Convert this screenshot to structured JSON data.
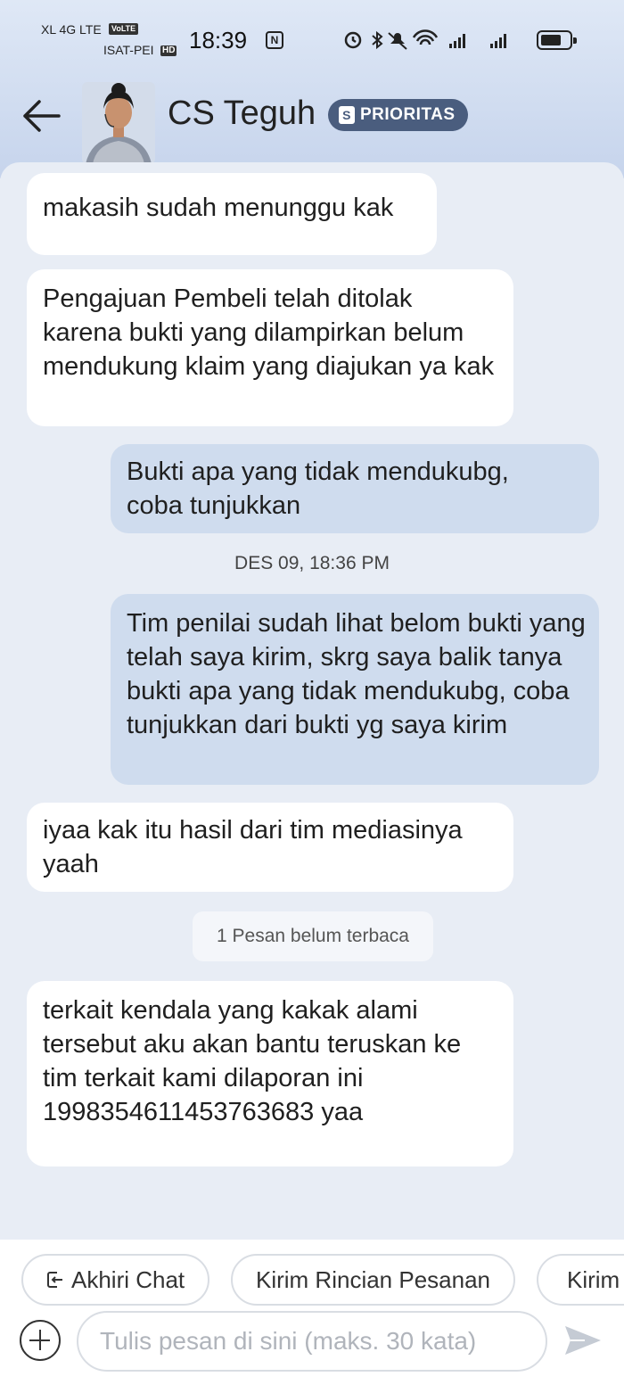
{
  "status_bar": {
    "carrier1": "XL 4G LTE",
    "volte": "VoLTE",
    "carrier2": "ISAT-PEI",
    "hd": "HD",
    "time": "18:39",
    "nfc": "N",
    "icons": [
      "alarm-icon",
      "bluetooth-icon",
      "mute-icon",
      "wifi-icon",
      "signal-icon",
      "signal-icon",
      "battery-icon"
    ]
  },
  "header": {
    "title": "CS Teguh",
    "badge": "PRIORITAS",
    "badge_icon": "shopee-bag-icon"
  },
  "messages": [
    {
      "side": "in",
      "text": "makasih sudah menunggu kak"
    },
    {
      "side": "in",
      "text": "Pengajuan Pembeli telah ditolak karena bukti yang dilampirkan belum mendukung klaim yang diajukan ya kak"
    },
    {
      "side": "out",
      "text": "Bukti apa yang tidak mendukubg, coba tunjukkan"
    },
    {
      "side": "date",
      "text": "DES 09, 18:36 PM"
    },
    {
      "side": "out",
      "text": "Tim penilai sudah lihat belom bukti yang telah saya kirim, skrg saya balik tanya bukti apa yang tidak mendukubg, coba tunjukkan dari bukti yg saya kirim"
    },
    {
      "side": "in",
      "text": "iyaa kak itu hasil dari tim mediasinya yaah"
    },
    {
      "side": "unread",
      "text": "1 Pesan belum terbaca"
    },
    {
      "side": "in",
      "text": "terkait kendala yang kakak alami tersebut aku akan bantu teruskan ke tim terkait kami dilaporan ini 1998354611453763683 yaa"
    }
  ],
  "quick_actions": [
    "Akhiri Chat",
    "Kirim Rincian Pesanan",
    "Kirim"
  ],
  "composer": {
    "placeholder": "Tulis pesan di sini (maks. 30 kata)"
  },
  "colors": {
    "header_bg": "#c6d4ec",
    "chat_bg": "#e8edf5",
    "incoming_bubble": "#ffffff",
    "outgoing_bubble": "#cfdcee",
    "badge_bg": "#4a5d7e"
  }
}
